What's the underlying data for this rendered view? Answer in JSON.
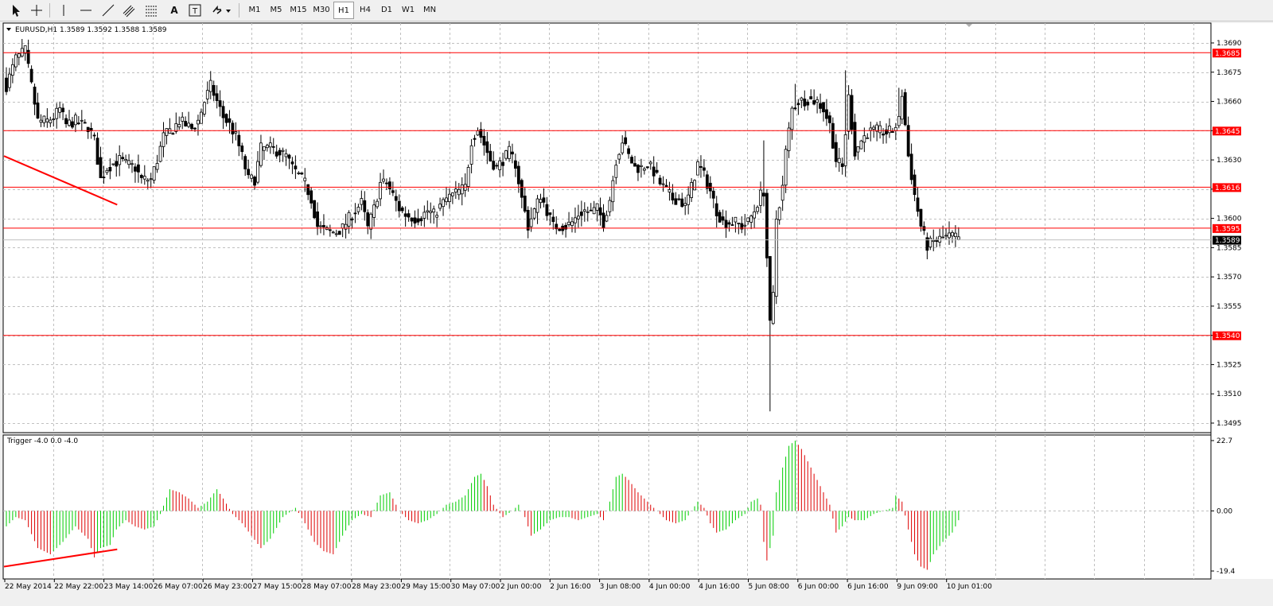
{
  "toolbar": {
    "timeframes": [
      {
        "label": "M1",
        "active": false
      },
      {
        "label": "M5",
        "active": false
      },
      {
        "label": "M15",
        "active": false
      },
      {
        "label": "M30",
        "active": false
      },
      {
        "label": "H1",
        "active": true
      },
      {
        "label": "H4",
        "active": false
      },
      {
        "label": "D1",
        "active": false
      },
      {
        "label": "W1",
        "active": false
      },
      {
        "label": "MN",
        "active": false
      }
    ],
    "tools": [
      "cursor-icon",
      "crosshair-icon",
      "vertical-line-icon",
      "horizontal-line-icon",
      "trendline-icon",
      "equidistant-channel-icon",
      "fibonacci-icon",
      "text-icon",
      "text-label-icon",
      "arrows-icon"
    ],
    "text_tool_label": "A",
    "label_tool_label": "T"
  },
  "chart_data": [
    {
      "type": "candlestick",
      "title": "EURUSD,H1  1.3589 1.3592 1.3588 1.3589",
      "symbol": "EURUSD",
      "timeframe": "H1",
      "last_ohlc": {
        "open": 1.3589,
        "high": 1.3592,
        "low": 1.3588,
        "close": 1.3589
      },
      "ylim": [
        1.349,
        1.3697
      ],
      "y_ticks": [
        "1.3690",
        "1.3675",
        "1.3660",
        "1.3645",
        "1.3630",
        "1.3615",
        "1.3600",
        "1.3585",
        "1.3570",
        "1.3555",
        "1.3540",
        "1.3525",
        "1.3510",
        "1.3495"
      ],
      "x_ticks": [
        "22 May 2014",
        "22 May 22:00",
        "23 May 14:00",
        "26 May 07:00",
        "26 May 23:00",
        "27 May 15:00",
        "28 May 07:00",
        "28 May 23:00",
        "29 May 15:00",
        "30 May 07:00",
        "2 Jun 00:00",
        "2 Jun 16:00",
        "3 Jun 08:00",
        "4 Jun 00:00",
        "4 Jun 16:00",
        "5 Jun 08:00",
        "6 Jun 00:00",
        "6 Jun 16:00",
        "9 Jun 09:00",
        "10 Jun 01:00"
      ],
      "horizontal_levels": [
        {
          "price": 1.3685,
          "label": "1.3685",
          "color": "#ff0000"
        },
        {
          "price": 1.3645,
          "label": "1.3645",
          "color": "#ff0000"
        },
        {
          "price": 1.3616,
          "label": "1.3616",
          "color": "#ff0000"
        },
        {
          "price": 1.3595,
          "label": "1.3595",
          "color": "#ff0000"
        },
        {
          "price": 1.354,
          "label": "1.3540",
          "color": "#ff0000"
        }
      ],
      "current_price": {
        "price": 1.3589,
        "label": "1.3589"
      },
      "trendline": {
        "from": {
          "bar": 0,
          "price": 1.3632
        },
        "to": {
          "bar": 34,
          "price": 1.3607
        },
        "color": "#ff0000"
      },
      "price_path": [
        [
          0,
          1.3668
        ],
        [
          3,
          1.3682
        ],
        [
          6,
          1.3686
        ],
        [
          8,
          1.3668
        ],
        [
          10,
          1.365
        ],
        [
          13,
          1.365
        ],
        [
          15,
          1.3652
        ],
        [
          17,
          1.3656
        ],
        [
          19,
          1.3648
        ],
        [
          22,
          1.365
        ],
        [
          24,
          1.3648
        ],
        [
          26,
          1.3647
        ],
        [
          28,
          1.364
        ],
        [
          30,
          1.362
        ],
        [
          32,
          1.3626
        ],
        [
          34,
          1.3628
        ],
        [
          36,
          1.363
        ],
        [
          38,
          1.3628
        ],
        [
          41,
          1.3626
        ],
        [
          43,
          1.362
        ],
        [
          46,
          1.362
        ],
        [
          48,
          1.363
        ],
        [
          50,
          1.3642
        ],
        [
          53,
          1.3646
        ],
        [
          55,
          1.365
        ],
        [
          57,
          1.3648
        ],
        [
          59,
          1.3646
        ],
        [
          61,
          1.365
        ],
        [
          63,
          1.366
        ],
        [
          65,
          1.3668
        ],
        [
          67,
          1.366
        ],
        [
          69,
          1.3652
        ],
        [
          71,
          1.3648
        ],
        [
          73,
          1.3642
        ],
        [
          75,
          1.3632
        ],
        [
          77,
          1.362
        ],
        [
          79,
          1.362
        ],
        [
          81,
          1.3636
        ],
        [
          84,
          1.3636
        ],
        [
          87,
          1.3634
        ],
        [
          89,
          1.3632
        ],
        [
          91,
          1.3626
        ],
        [
          93,
          1.3622
        ],
        [
          95,
          1.3618
        ],
        [
          97,
          1.361
        ],
        [
          99,
          1.3596
        ],
        [
          101,
          1.3594
        ],
        [
          103,
          1.3593
        ],
        [
          105,
          1.3593
        ],
        [
          107,
          1.3595
        ],
        [
          109,
          1.36
        ],
        [
          111,
          1.3604
        ],
        [
          113,
          1.3608
        ],
        [
          115,
          1.3595
        ],
        [
          117,
          1.3605
        ],
        [
          119,
          1.3618
        ],
        [
          121,
          1.3618
        ],
        [
          123,
          1.3612
        ],
        [
          125,
          1.3605
        ],
        [
          127,
          1.3602
        ],
        [
          130,
          1.36
        ],
        [
          132,
          1.3601
        ],
        [
          134,
          1.3604
        ],
        [
          136,
          1.3602
        ],
        [
          138,
          1.3606
        ],
        [
          140,
          1.361
        ],
        [
          142,
          1.3612
        ],
        [
          144,
          1.3614
        ],
        [
          146,
          1.3616
        ],
        [
          148,
          1.364
        ],
        [
          150,
          1.3646
        ],
        [
          152,
          1.3638
        ],
        [
          154,
          1.363
        ],
        [
          156,
          1.3626
        ],
        [
          158,
          1.363
        ],
        [
          160,
          1.3634
        ],
        [
          162,
          1.3628
        ],
        [
          164,
          1.361
        ],
        [
          166,
          1.3596
        ],
        [
          168,
          1.3604
        ],
        [
          170,
          1.3612
        ],
        [
          172,
          1.3604
        ],
        [
          174,
          1.3596
        ],
        [
          176,
          1.3596
        ],
        [
          178,
          1.3596
        ],
        [
          180,
          1.3598
        ],
        [
          182,
          1.3602
        ],
        [
          184,
          1.3604
        ],
        [
          186,
          1.3603
        ],
        [
          188,
          1.3605
        ],
        [
          190,
          1.3598
        ],
        [
          192,
          1.361
        ],
        [
          194,
          1.363
        ],
        [
          196,
          1.364
        ],
        [
          198,
          1.3632
        ],
        [
          200,
          1.3626
        ],
        [
          202,
          1.3626
        ],
        [
          204,
          1.3628
        ],
        [
          206,
          1.3624
        ],
        [
          208,
          1.3618
        ],
        [
          210,
          1.3614
        ],
        [
          212,
          1.361
        ],
        [
          214,
          1.361
        ],
        [
          216,
          1.3606
        ],
        [
          218,
          1.3616
        ],
        [
          220,
          1.3628
        ],
        [
          222,
          1.3622
        ],
        [
          224,
          1.3614
        ],
        [
          226,
          1.3604
        ],
        [
          228,
          1.3598
        ],
        [
          230,
          1.3598
        ],
        [
          232,
          1.3598
        ],
        [
          234,
          1.3596
        ],
        [
          236,
          1.3598
        ],
        [
          238,
          1.3604
        ],
        [
          240,
          1.3612
        ],
        [
          241,
          1.3614
        ],
        [
          242,
          1.358
        ],
        [
          243,
          1.3545
        ],
        [
          244,
          1.356
        ],
        [
          245,
          1.36
        ],
        [
          247,
          1.3616
        ],
        [
          248,
          1.3634
        ],
        [
          250,
          1.3656
        ],
        [
          252,
          1.366
        ],
        [
          255,
          1.3661
        ],
        [
          258,
          1.366
        ],
        [
          260,
          1.3656
        ],
        [
          262,
          1.3648
        ],
        [
          264,
          1.363
        ],
        [
          266,
          1.3626
        ],
        [
          268,
          1.3662
        ],
        [
          270,
          1.3634
        ],
        [
          272,
          1.364
        ],
        [
          274,
          1.3644
        ],
        [
          277,
          1.3645
        ],
        [
          280,
          1.3644
        ],
        [
          282,
          1.3645
        ],
        [
          284,
          1.365
        ],
        [
          285,
          1.3664
        ],
        [
          287,
          1.3632
        ],
        [
          289,
          1.3612
        ],
        [
          291,
          1.3596
        ],
        [
          293,
          1.3586
        ],
        [
          295,
          1.3588
        ],
        [
          298,
          1.359
        ],
        [
          301,
          1.3591
        ],
        [
          303,
          1.3589
        ]
      ],
      "wicks": [
        {
          "bar": 243,
          "low": 1.3501
        },
        {
          "bar": 241,
          "high": 1.364
        },
        {
          "bar": 267,
          "high": 1.3676
        },
        {
          "bar": 6,
          "high": 1.3688
        },
        {
          "bar": 251,
          "high": 1.3669
        },
        {
          "bar": 284,
          "high": 1.3667
        }
      ]
    },
    {
      "type": "histogram",
      "title": "Trigger -4.0 0.0 -4.0",
      "ylim": [
        -19.4,
        22.7
      ],
      "y_ticks": [
        "22.7",
        "0.00",
        "-19.4"
      ],
      "colors": {
        "rising": "#00cc00",
        "falling": "#dd0000"
      },
      "trendline": {
        "from": {
          "bar": 0,
          "value": -18.0
        },
        "to": {
          "bar": 34,
          "value": -12.4
        },
        "color": "#ff0000"
      },
      "value_path": [
        [
          0,
          -5
        ],
        [
          3,
          -2
        ],
        [
          6,
          -3
        ],
        [
          10,
          -12
        ],
        [
          14,
          -14
        ],
        [
          18,
          -10
        ],
        [
          22,
          -5
        ],
        [
          26,
          -9
        ],
        [
          28,
          -15
        ],
        [
          30,
          -12
        ],
        [
          33,
          -11
        ],
        [
          35,
          -6
        ],
        [
          38,
          -3
        ],
        [
          41,
          -5
        ],
        [
          44,
          -6
        ],
        [
          47,
          -5
        ],
        [
          49,
          -1
        ],
        [
          52,
          7
        ],
        [
          55,
          6
        ],
        [
          58,
          4
        ],
        [
          61,
          1
        ],
        [
          64,
          3
        ],
        [
          67,
          7
        ],
        [
          69,
          4
        ],
        [
          72,
          -1
        ],
        [
          75,
          -4
        ],
        [
          78,
          -8
        ],
        [
          81,
          -12
        ],
        [
          84,
          -9
        ],
        [
          88,
          -2
        ],
        [
          92,
          1
        ],
        [
          95,
          -4
        ],
        [
          98,
          -10
        ],
        [
          101,
          -13
        ],
        [
          104,
          -14
        ],
        [
          107,
          -8
        ],
        [
          110,
          -3
        ],
        [
          113,
          -1
        ],
        [
          116,
          -2
        ],
        [
          119,
          5
        ],
        [
          122,
          6
        ],
        [
          125,
          0
        ],
        [
          128,
          -3
        ],
        [
          131,
          -4
        ],
        [
          134,
          -3
        ],
        [
          137,
          -1
        ],
        [
          140,
          2
        ],
        [
          143,
          3
        ],
        [
          146,
          5
        ],
        [
          149,
          11
        ],
        [
          151,
          12
        ],
        [
          153,
          8
        ],
        [
          155,
          2
        ],
        [
          158,
          -2
        ],
        [
          161,
          0
        ],
        [
          163,
          2
        ],
        [
          165,
          -2
        ],
        [
          167,
          -8
        ],
        [
          170,
          -6
        ],
        [
          173,
          -3
        ],
        [
          176,
          -2
        ],
        [
          179,
          -2
        ],
        [
          182,
          -3
        ],
        [
          185,
          -2
        ],
        [
          188,
          -1
        ],
        [
          190,
          -3
        ],
        [
          192,
          3
        ],
        [
          194,
          11
        ],
        [
          196,
          12
        ],
        [
          198,
          10
        ],
        [
          201,
          6
        ],
        [
          204,
          3
        ],
        [
          207,
          0
        ],
        [
          210,
          -3
        ],
        [
          213,
          -4
        ],
        [
          216,
          -3
        ],
        [
          218,
          0
        ],
        [
          220,
          3
        ],
        [
          222,
          1
        ],
        [
          224,
          -4
        ],
        [
          226,
          -7
        ],
        [
          229,
          -6
        ],
        [
          232,
          -3
        ],
        [
          235,
          -1
        ],
        [
          237,
          3
        ],
        [
          239,
          4
        ],
        [
          240,
          2
        ],
        [
          241,
          -10
        ],
        [
          242,
          -16
        ],
        [
          243,
          -12
        ],
        [
          244,
          -8
        ],
        [
          245,
          6
        ],
        [
          247,
          14
        ],
        [
          249,
          21
        ],
        [
          251,
          22.7
        ],
        [
          253,
          20
        ],
        [
          256,
          14
        ],
        [
          259,
          8
        ],
        [
          262,
          2
        ],
        [
          264,
          -7
        ],
        [
          266,
          -5
        ],
        [
          268,
          -2
        ],
        [
          270,
          -3
        ],
        [
          273,
          -3
        ],
        [
          276,
          -1
        ],
        [
          279,
          0
        ],
        [
          282,
          1
        ],
        [
          283,
          5
        ],
        [
          285,
          3
        ],
        [
          287,
          -6
        ],
        [
          289,
          -14
        ],
        [
          291,
          -18
        ],
        [
          293,
          -19
        ],
        [
          295,
          -14
        ],
        [
          298,
          -10
        ],
        [
          301,
          -7
        ],
        [
          303,
          -3
        ]
      ]
    }
  ]
}
